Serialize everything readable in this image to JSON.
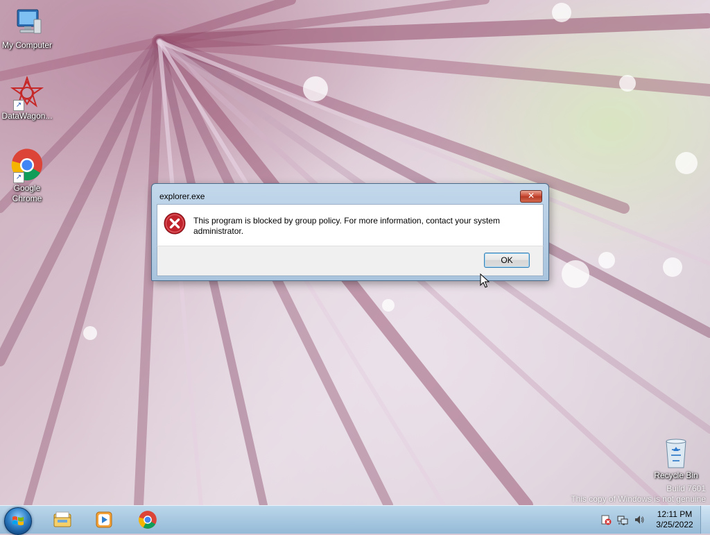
{
  "desktop_icons": {
    "my_computer": "My Computer",
    "datawagon": "DataWagon...",
    "chrome_line1": "Google",
    "chrome_line2": "Chrome",
    "recycle_bin": "Recycle Bin"
  },
  "watermark": {
    "build": "Build 7601",
    "genuine": "This copy of Windows is not genuine"
  },
  "dialog": {
    "title": "explorer.exe",
    "message_line1": "This program is blocked by group policy. For more information, contact your system",
    "message_line2": "administrator.",
    "ok_label": "OK",
    "close_label": "✕"
  },
  "taskbar": {
    "pinned": [
      "windows-explorer",
      "windows-media-player",
      "google-chrome"
    ],
    "clock": {
      "time": "12:11 PM",
      "date": "3/25/2022"
    }
  },
  "colors": {
    "dialog_frame": "#a9c4de",
    "close_button": "#c7442f",
    "error_icon": "#c0232b",
    "taskbar": "#9fc2dd"
  }
}
